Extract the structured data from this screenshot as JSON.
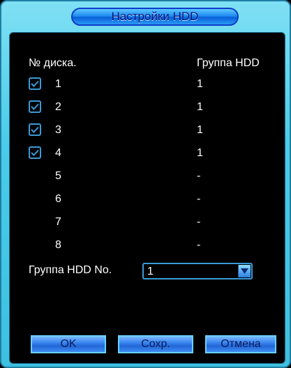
{
  "dialog": {
    "title": "Настройки HDD"
  },
  "headers": {
    "disk_no": "№ диска.",
    "hdd_group": "Группа HDD"
  },
  "disks": [
    {
      "number": "1",
      "group": "1",
      "checkbox": true
    },
    {
      "number": "2",
      "group": "1",
      "checkbox": true
    },
    {
      "number": "3",
      "group": "1",
      "checkbox": true
    },
    {
      "number": "4",
      "group": "1",
      "checkbox": true
    },
    {
      "number": "5",
      "group": "-",
      "checkbox": false
    },
    {
      "number": "6",
      "group": "-",
      "checkbox": false
    },
    {
      "number": "7",
      "group": "-",
      "checkbox": false
    },
    {
      "number": "8",
      "group": "-",
      "checkbox": false
    }
  ],
  "hdd_group_no": {
    "label": "Группа HDD No.",
    "value": "1"
  },
  "buttons": {
    "ok": "OK",
    "save": "Сохр.",
    "cancel": "Отмена"
  },
  "colors": {
    "frame": "#49cbe9",
    "panel": "#000000",
    "text": "#ffffff",
    "button": "#3a86f0",
    "checkbox_border": "#3a9ad9"
  }
}
